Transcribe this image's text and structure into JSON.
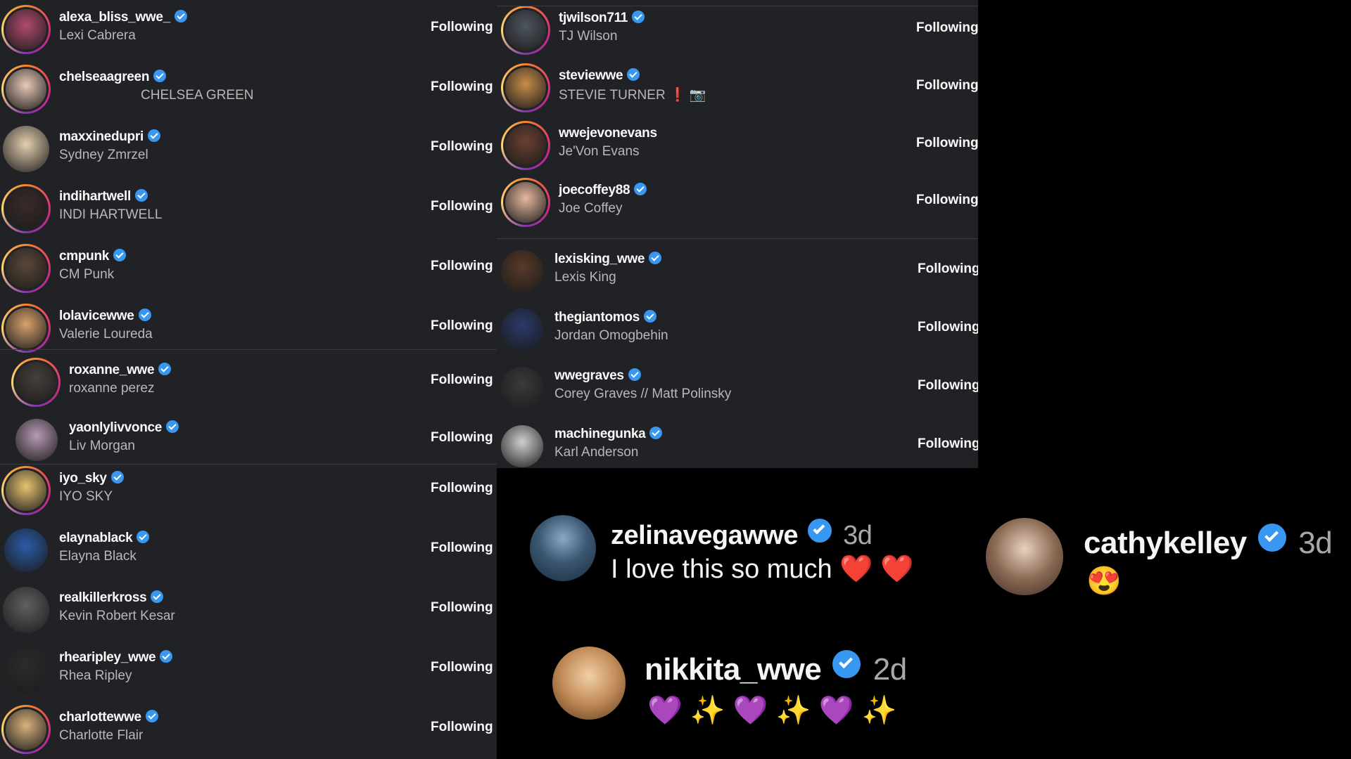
{
  "left_list": [
    {
      "username": "alexa_bliss_wwe_",
      "full_name": "Lexi Cabrera",
      "button": "Following"
    },
    {
      "username": "chelseaagreen",
      "full_name": "CHELSEA GREEN",
      "button": "Following"
    },
    {
      "username": "maxxinedupri",
      "full_name": "Sydney Zmrzel",
      "button": "Following"
    },
    {
      "username": "indihartwell",
      "full_name": "INDI HARTWELL",
      "button": "Following"
    },
    {
      "username": "cmpunk",
      "full_name": "CM Punk",
      "button": "Following"
    },
    {
      "username": "lolavicewwe",
      "full_name": "Valerie Loureda",
      "button": "Following"
    },
    {
      "username": "roxanne_wwe",
      "full_name": "roxanne perez",
      "button": "Following"
    },
    {
      "username": "yaonlylivvonce",
      "full_name": "Liv Morgan",
      "button": "Following"
    },
    {
      "username": "iyo_sky",
      "full_name": "IYO SKY",
      "button": "Following"
    },
    {
      "username": "elaynablack",
      "full_name": "Elayna Black",
      "button": "Following"
    },
    {
      "username": "realkillerkross",
      "full_name": "Kevin Robert Kesar",
      "button": "Following"
    },
    {
      "username": "rhearipley_wwe",
      "full_name": "Rhea Ripley",
      "button": "Following"
    },
    {
      "username": "charlottewwe",
      "full_name": "Charlotte Flair",
      "button": "Following"
    }
  ],
  "right_list": [
    {
      "username": "tjwilson711",
      "full_name": "TJ Wilson",
      "button": "Following"
    },
    {
      "username": "steviewwe",
      "full_name": "STEVIE TURNER ❗ 📷",
      "button": "Following"
    },
    {
      "username": "wwejevonevans",
      "full_name": "Je'Von Evans",
      "button": "Following"
    },
    {
      "username": "joecoffey88",
      "full_name": "Joe Coffey",
      "button": "Following"
    },
    {
      "username": "lexisking_wwe",
      "full_name": "Lexis King",
      "button": "Following"
    },
    {
      "username": "thegiantomos",
      "full_name": "Jordan Omogbehin",
      "button": "Following"
    },
    {
      "username": "wwegraves",
      "full_name": "Corey Graves // Matt Polinsky",
      "button": "Following"
    },
    {
      "username": "machinegunka",
      "full_name": "Karl Anderson",
      "button": "Following"
    }
  ],
  "comments": [
    {
      "username": "zelinavegawwe",
      "time": "3d",
      "text": "I love this so much ❤️ ❤️"
    },
    {
      "username": "cathykelley",
      "time": "3d",
      "text": "😍"
    },
    {
      "username": "nikkita_wwe",
      "time": "2d",
      "text": "💜 ✨ 💜 ✨ 💜 ✨"
    }
  ],
  "colors": {
    "panel_bg": "#212226",
    "verified": "#3897f0",
    "name_secondary": "#b8b8b8"
  }
}
